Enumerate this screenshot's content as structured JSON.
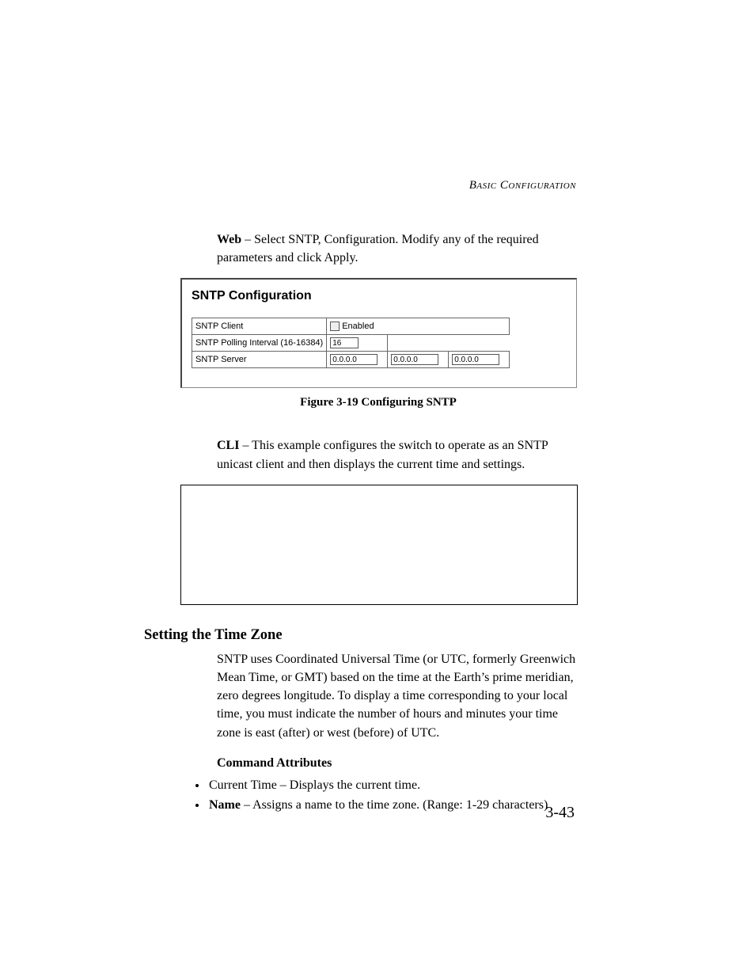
{
  "header": {
    "running": "Basic Configuration"
  },
  "intro_web": {
    "lead": "Web",
    "text": " – Select SNTP, Configuration. Modify any of the required parameters and click Apply."
  },
  "figure": {
    "title": "SNTP Configuration",
    "rows": {
      "client_label": "SNTP Client",
      "client_value": "Enabled",
      "poll_label": "SNTP Polling Interval (16-16384)",
      "poll_value": "16",
      "server_label": "SNTP Server",
      "server_v1": "0.0.0.0",
      "server_v2": "0.0.0.0",
      "server_v3": "0.0.0.0"
    },
    "caption": "Figure 3-19  Configuring SNTP"
  },
  "intro_cli": {
    "lead": "CLI",
    "text": " – This example configures the switch to operate as an SNTP unicast client and then displays the current time and settings."
  },
  "section": {
    "heading": "Setting the Time Zone",
    "body": "SNTP uses Coordinated Universal Time (or UTC, formerly Greenwich Mean Time, or GMT) based on the time at the Earth’s prime meridian, zero degrees longitude. To display a time corresponding to your local time, you must indicate the number of hours and minutes your time zone is east (after) or west (before) of UTC."
  },
  "attrs": {
    "heading": "Command Attributes",
    "items": [
      {
        "text": "Current Time – Displays the current time."
      },
      {
        "lead": "Name",
        "text": " – Assigns a name to the time zone. (Range: 1-29 characters)"
      }
    ]
  },
  "page_number": "3-43"
}
